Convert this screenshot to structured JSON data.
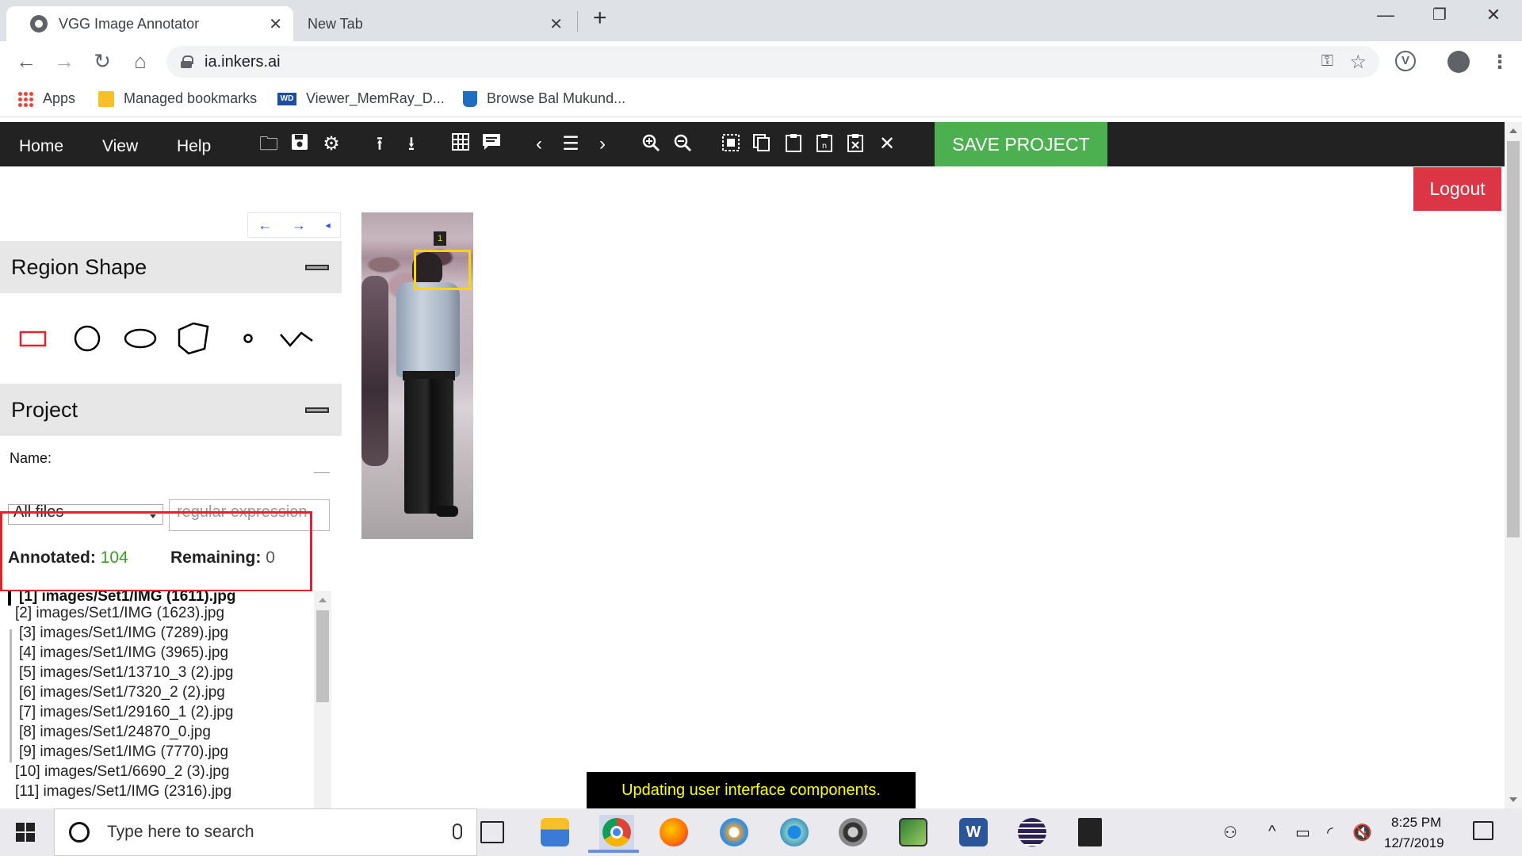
{
  "browser": {
    "tabs": [
      {
        "title": "VGG Image Annotator",
        "active": true
      },
      {
        "title": "New Tab",
        "active": false
      }
    ],
    "new_tab": "+",
    "url": "ia.inkers.ai",
    "bookmarks": [
      {
        "label": "Apps",
        "icon": "apps-grid-icon"
      },
      {
        "label": "Managed bookmarks",
        "icon": "folder-icon"
      },
      {
        "label": "Viewer_MemRay_D...",
        "icon": "wd-icon"
      },
      {
        "label": "Browse Bal Mukund...",
        "icon": "bucket-icon"
      }
    ]
  },
  "app": {
    "menu": [
      "Home",
      "View",
      "Help"
    ],
    "toolbar_icons": [
      "open-folder-icon",
      "save-icon",
      "settings-icon",
      "upload-icon",
      "download-icon",
      "grid-icon",
      "comment-icon",
      "prev-icon",
      "list-icon",
      "next-icon",
      "zoom-in-icon",
      "zoom-out-icon",
      "select-all-icon",
      "copy-icon",
      "paste-icon",
      "paste-n-icon",
      "paste-x-icon",
      "close-icon"
    ],
    "save_project": "SAVE PROJECT",
    "logout": "Logout",
    "panel_nav": [
      "←",
      "→",
      "◂"
    ],
    "region_shape": {
      "title": "Region Shape",
      "shapes": [
        "rectangle",
        "circle",
        "ellipse",
        "polygon",
        "point",
        "polyline"
      ],
      "selected": "rectangle",
      "accent": "#e8202e"
    },
    "project": {
      "title": "Project",
      "name_label": "Name:",
      "filter_value": "All files",
      "regex_placeholder": "regular expression",
      "annotated_label": "Annotated:",
      "annotated_value": "104",
      "remaining_label": "Remaining:",
      "remaining_value": "0",
      "files": [
        "[1] images/Set1/IMG (1611).jpg",
        "[2] images/Set1/IMG (1623).jpg",
        "[3] images/Set1/IMG (7289).jpg",
        "[4] images/Set1/IMG (3965).jpg",
        "[5] images/Set1/13710_3 (2).jpg",
        "[6] images/Set1/7320_2 (2).jpg",
        "[7] images/Set1/29160_1 (2).jpg",
        "[8] images/Set1/24870_0.jpg",
        "[9] images/Set1/IMG (7770).jpg",
        "[10] images/Set1/6690_2 (3).jpg",
        "[11] images/Set1/IMG (2316).jpg"
      ],
      "current_file_index": 0
    },
    "region_label": "1",
    "status_message": "Updating user interface components.",
    "colors": {
      "appbar": "#222222",
      "save_green": "#4CAF50",
      "logout_red": "#dc3545",
      "bbox_yellow": "#ffd400",
      "annotated_green": "#3a9d23"
    }
  },
  "taskbar": {
    "search_placeholder": "Type here to search",
    "time": "8:25 PM",
    "date": "12/7/2019"
  }
}
